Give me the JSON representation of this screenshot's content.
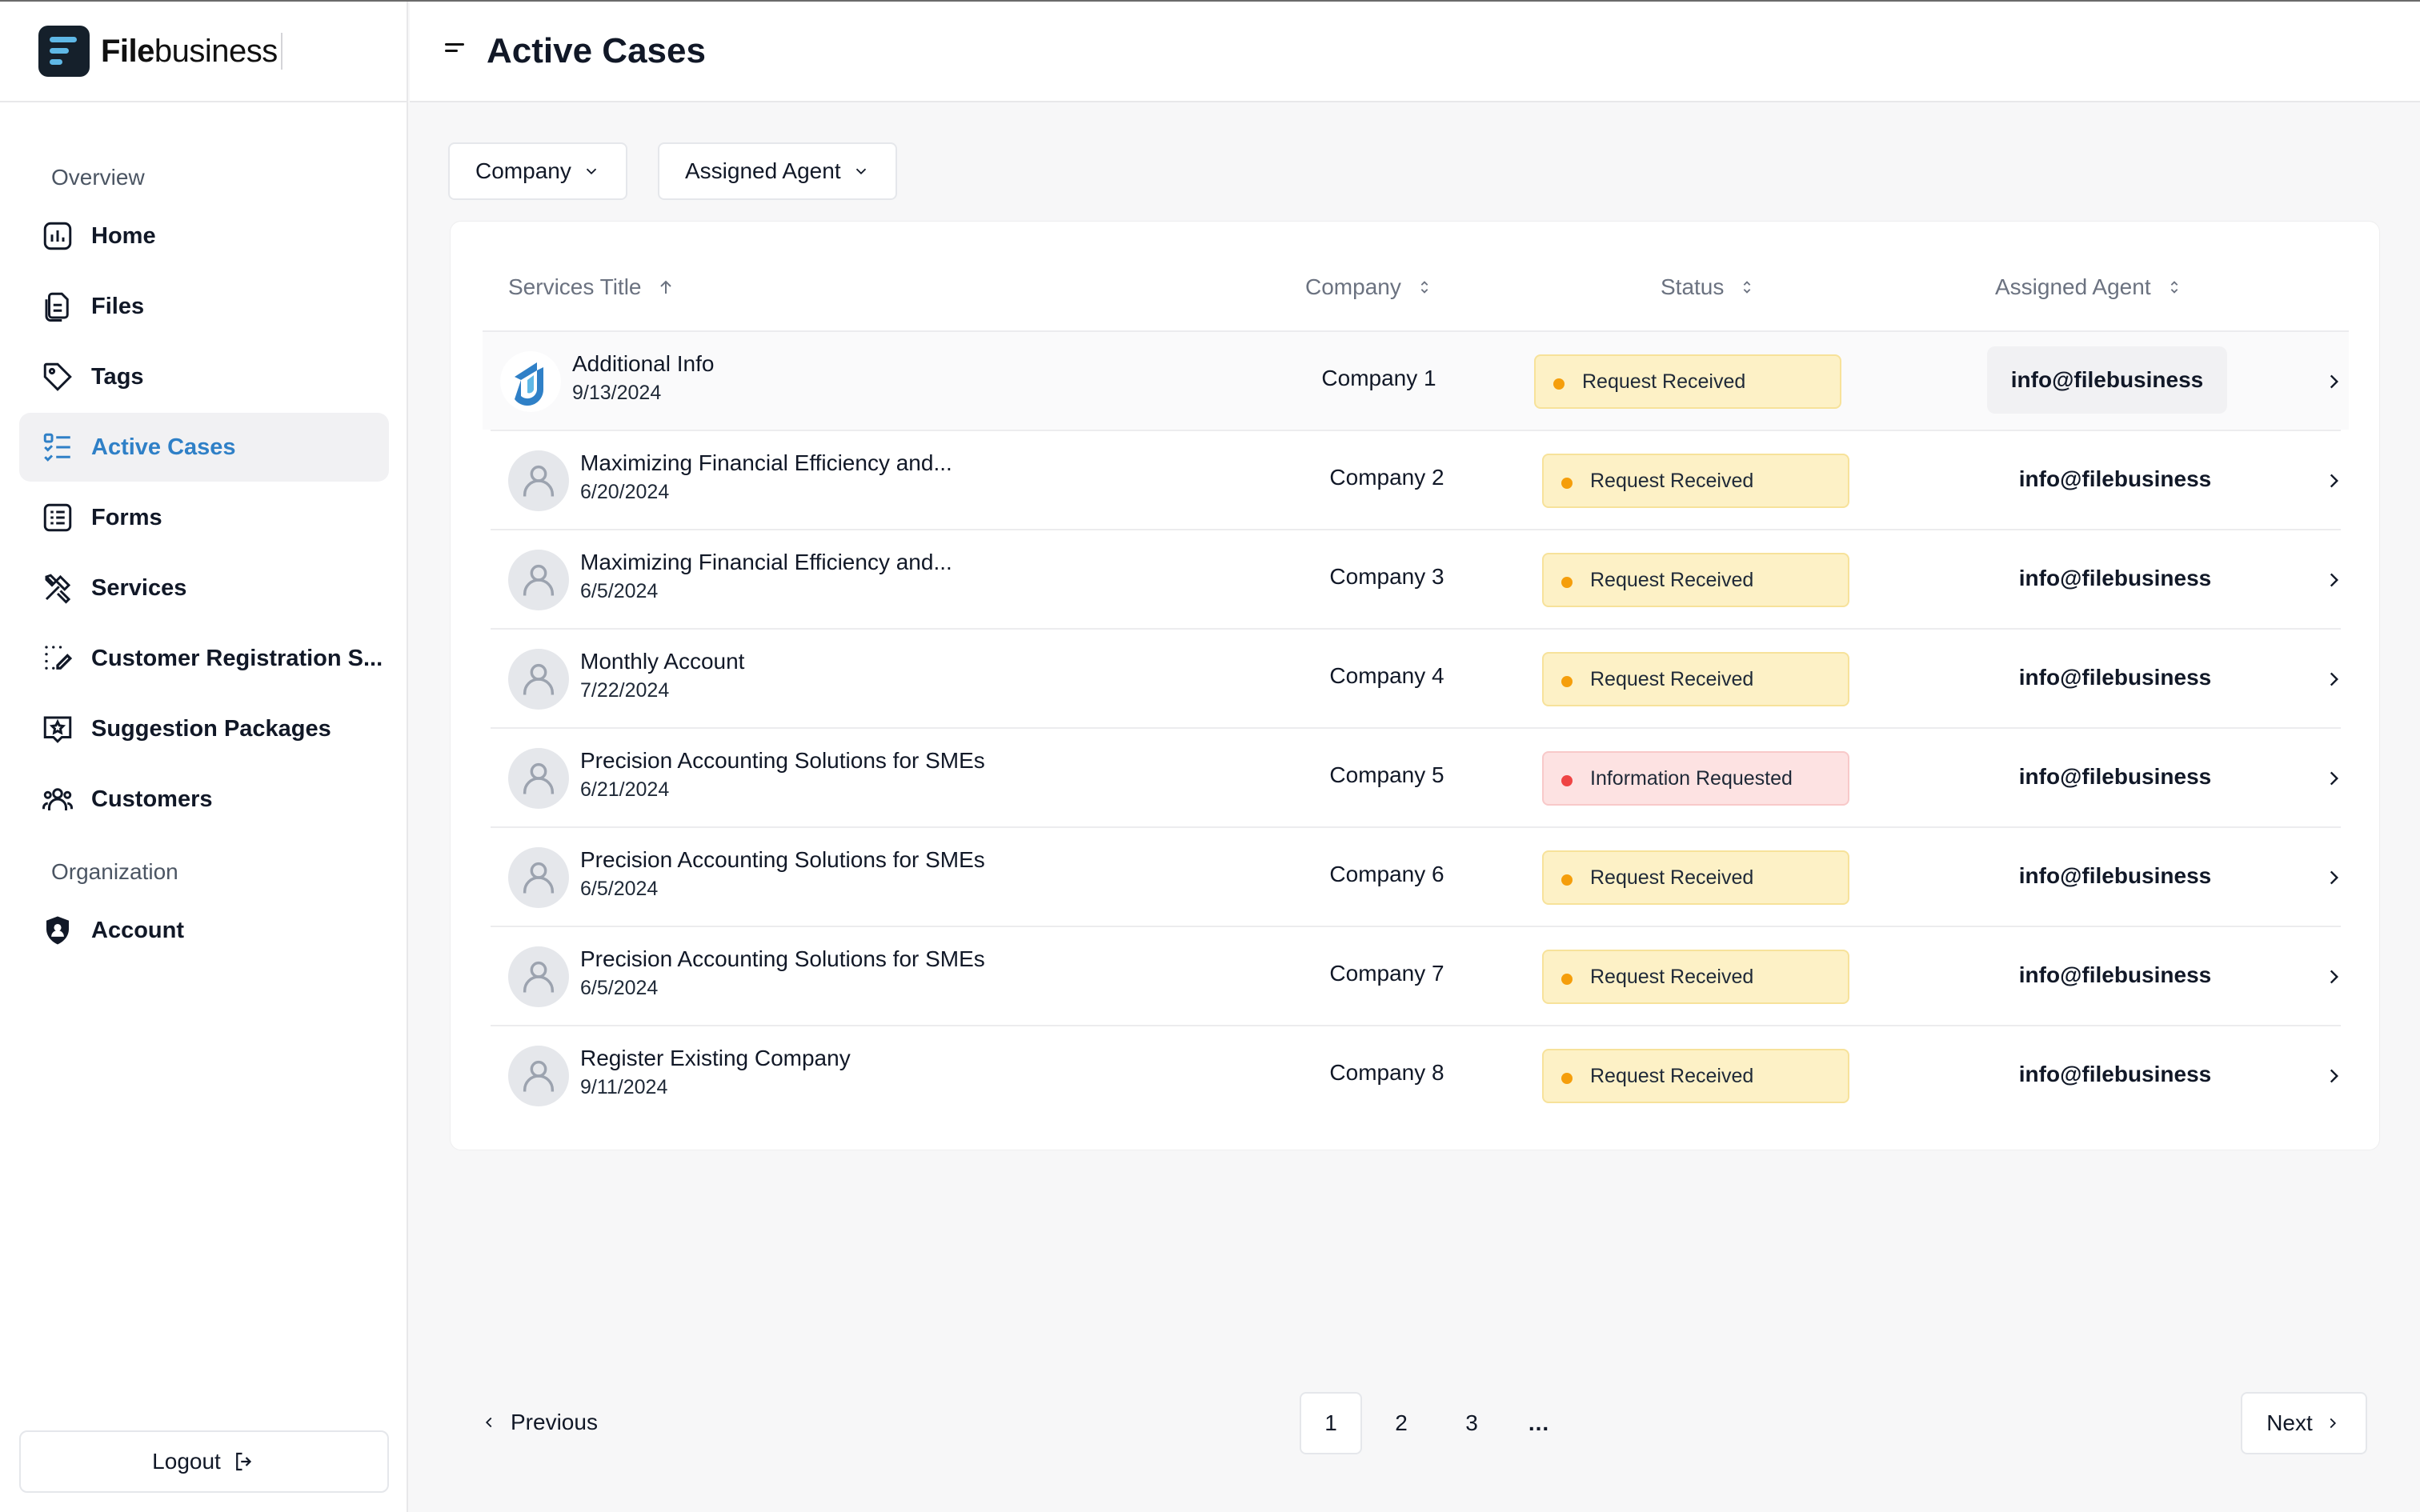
{
  "brand": {
    "name_bold": "File",
    "name_regular": "business"
  },
  "sidebar": {
    "overview_label": "Overview",
    "organization_label": "Organization",
    "items": [
      {
        "label": "Home",
        "icon": "chart-bars-icon"
      },
      {
        "label": "Files",
        "icon": "files-icon"
      },
      {
        "label": "Tags",
        "icon": "tag-icon"
      },
      {
        "label": "Active Cases",
        "icon": "list-check-icon",
        "active": true
      },
      {
        "label": "Forms",
        "icon": "form-icon"
      },
      {
        "label": "Services",
        "icon": "tools-icon"
      },
      {
        "label": "Customer Registration S...",
        "icon": "dotted-edit-icon"
      },
      {
        "label": "Suggestion Packages",
        "icon": "package-icon"
      },
      {
        "label": "Customers",
        "icon": "users-icon"
      }
    ],
    "org_items": [
      {
        "label": "Account",
        "icon": "shield-user-icon"
      }
    ],
    "logout_label": "Logout"
  },
  "header": {
    "title": "Active Cases"
  },
  "filters": {
    "company": "Company",
    "agent": "Assigned Agent"
  },
  "table": {
    "columns": {
      "title": "Services Title",
      "company": "Company",
      "status": "Status",
      "agent": "Assigned Agent"
    },
    "rows": [
      {
        "title": "Additional Info",
        "date": "9/13/2024",
        "company": "Company 1",
        "status": "Request Received",
        "agent": "info@filebusiness",
        "avatar": "brand-logo"
      },
      {
        "title": "Maximizing Financial Efficiency and...",
        "date": "6/20/2024",
        "company": "Company 2",
        "status": "Request Received",
        "agent": "info@filebusiness",
        "avatar": "user"
      },
      {
        "title": "Maximizing Financial Efficiency and...",
        "date": "6/5/2024",
        "company": "Company 3",
        "status": "Request Received",
        "agent": "info@filebusiness",
        "avatar": "user"
      },
      {
        "title": "Monthly Account",
        "date": "7/22/2024",
        "company": "Company 4",
        "status": "Request Received",
        "agent": "info@filebusiness",
        "avatar": "user"
      },
      {
        "title": "Precision Accounting Solutions for SMEs",
        "date": "6/21/2024",
        "company": "Company 5",
        "status": "Information Requested",
        "agent": "info@filebusiness",
        "avatar": "user"
      },
      {
        "title": "Precision Accounting Solutions for SMEs",
        "date": "6/5/2024",
        "company": "Company 6",
        "status": "Request Received",
        "agent": "info@filebusiness",
        "avatar": "user"
      },
      {
        "title": "Precision Accounting Solutions for SMEs",
        "date": "6/5/2024",
        "company": "Company 7",
        "status": "Request Received",
        "agent": "info@filebusiness",
        "avatar": "user"
      },
      {
        "title": "Register Existing Company",
        "date": "9/11/2024",
        "company": "Company 8",
        "status": "Request Received",
        "agent": "info@filebusiness",
        "avatar": "user"
      }
    ]
  },
  "status_colors": {
    "Request Received": {
      "bg": "#fdf1c6",
      "border": "#f7e29a",
      "dot": "#f59e0b"
    },
    "Information Requested": {
      "bg": "#fde2e2",
      "border": "#f8c9c9",
      "dot": "#ef4444"
    }
  },
  "pagination": {
    "previous": "Previous",
    "next": "Next",
    "pages": [
      "1",
      "2",
      "3"
    ],
    "ellipsis": "...",
    "current": "1"
  },
  "colors": {
    "accent": "#2f80c7",
    "logo_bg": "#15202b",
    "logo_bars": "#5fb8e6"
  }
}
